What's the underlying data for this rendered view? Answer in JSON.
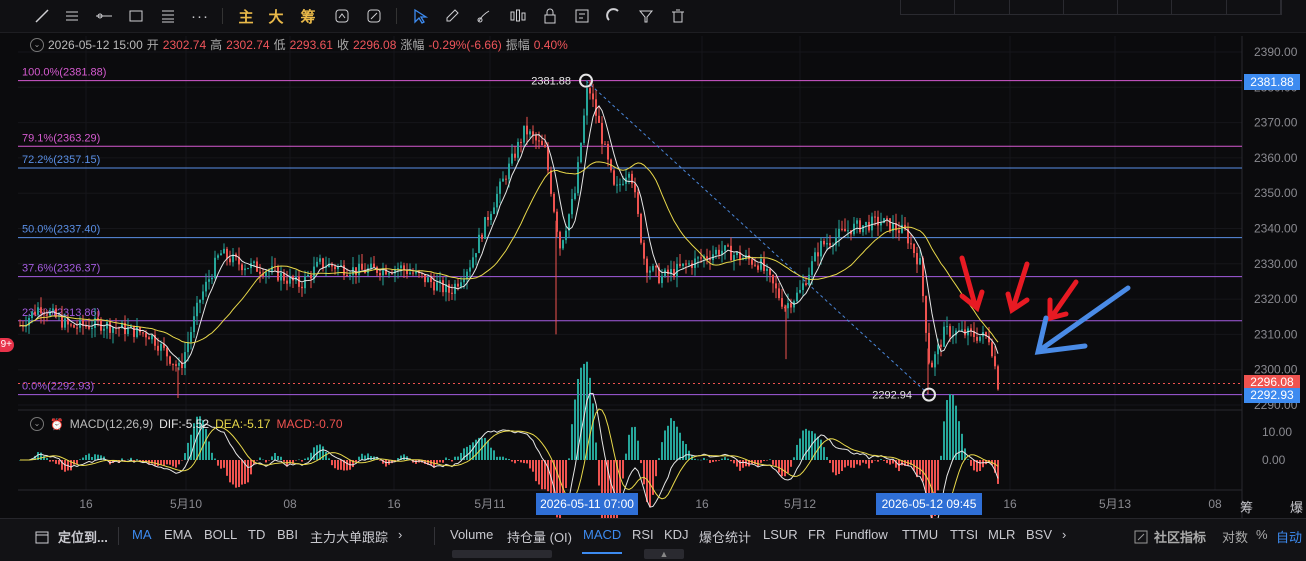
{
  "toolbar": {
    "tools": [
      "trend-line-icon",
      "horizontal-lines-icon",
      "ray-icon",
      "rectangle-icon",
      "fib-icon",
      "more-icon"
    ],
    "indicator_labels": [
      "主",
      "大",
      "筹"
    ],
    "more_label": "···"
  },
  "ohlc": {
    "datetime": "2026-05-12 15:00",
    "open_label": "开",
    "open": "2302.74",
    "high_label": "高",
    "high": "2302.74",
    "low_label": "低",
    "low": "2293.61",
    "close_label": "收",
    "close": "2296.08",
    "change_label": "涨幅",
    "change": "-0.29%(-6.66)",
    "amp_label": "振幅",
    "amp": "0.40%"
  },
  "fib_levels": [
    {
      "label": "100.0%(2381.88)",
      "price": 2381.88,
      "color": "#d65bd0"
    },
    {
      "label": "79.1%(2363.29)",
      "price": 2363.29,
      "color": "#d65bd0"
    },
    {
      "label": "72.2%(2357.15)",
      "price": 2357.15,
      "color": "#5a8fe6"
    },
    {
      "label": "50.0%(2337.40)",
      "price": 2337.4,
      "color": "#5a8fe6"
    },
    {
      "label": "37.6%(2326.37)",
      "price": 2326.37,
      "color": "#a55ce0"
    },
    {
      "label": "23.6%(2313.86)",
      "price": 2313.86,
      "color": "#a55ce0"
    },
    {
      "label": "0.0%(2292.93)",
      "price": 2292.93,
      "color": "#a55ce0"
    }
  ],
  "price_axis": {
    "ticks": [
      "2390.00",
      "2380.00",
      "2370.00",
      "2360.00",
      "2350.00",
      "2340.00",
      "2330.00",
      "2320.00",
      "2310.00",
      "2300.00",
      "2290.00"
    ],
    "high_tag": "2381.88",
    "current_tag": "2296.08",
    "low_tag": "2292.93"
  },
  "annotations": {
    "high_point": "2381.88",
    "low_point": "2292.94"
  },
  "macd": {
    "name": "MACD(12,26,9)",
    "dif_label": "DIF:",
    "dif": "-5.52",
    "dea_label": "DEA:",
    "dea": "-5.17",
    "macd_label": "MACD:",
    "macd": "-0.70",
    "ticks": [
      "10.00",
      "0.00"
    ]
  },
  "time_axis": {
    "labels": [
      "16",
      "5月10",
      "08",
      "16",
      "5月11",
      "16",
      "5月12",
      "16",
      "5月13",
      "08"
    ],
    "cursor_left": "2026-05-11 07:00",
    "cursor_right": "2026-05-12 09:45",
    "right_label_1": "筹",
    "right_label_2": "爆"
  },
  "bottom_bar": {
    "locate": "定位到...",
    "main_indicators": [
      "MA",
      "EMA",
      "BOLL",
      "TD",
      "BBI",
      "主力大单跟踪"
    ],
    "sub_indicators": [
      "Volume",
      "持仓量 (OI)",
      "MACD",
      "RSI",
      "KDJ",
      "爆仓统计",
      "LSUR",
      "FR",
      "Fundflow",
      "TTMU",
      "TTSI",
      "MLR",
      "BSV"
    ],
    "community": "社区指标",
    "log": "对数",
    "percent": "%",
    "auto": "自动"
  },
  "colors": {
    "up": "#26a69a",
    "down": "#ef5350",
    "accent": "#3d8bf0",
    "ma_white": "#e6e6e6",
    "ma_yellow": "#e8d84a"
  }
}
